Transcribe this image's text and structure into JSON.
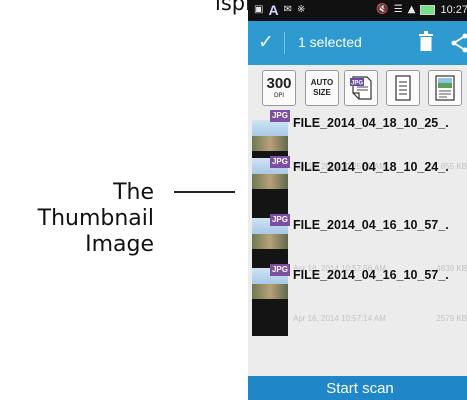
{
  "caption": {
    "top_text": "isplayed."
  },
  "annotation": {
    "line1": "The",
    "line2": "Thumbnail",
    "line3": "Image"
  },
  "status_bar": {
    "time": "10:27"
  },
  "action_bar": {
    "title": "1 selected"
  },
  "toolbar": {
    "resolution_value": "300",
    "resolution_unit": "DPI",
    "auto_size_line1": "AUTO",
    "auto_size_line2": "SIZE",
    "jpg_icon_label": "JPG"
  },
  "files": [
    {
      "name": "FILE_2014_04_18_10_25_.",
      "date": "Apr 18, 2014 10:25:55 AM",
      "size": "855 KB",
      "type": "JPG"
    },
    {
      "name": "FILE_2014_04_18_10_24_.",
      "date": "",
      "size": "",
      "type": "JPG"
    },
    {
      "name": "FILE_2014_04_16_10_57_.",
      "date": "Apr 16, 2014 10:57:56 AM",
      "size": "4839 KB",
      "type": "JPG"
    },
    {
      "name": "FILE_2014_04_16_10_57_.",
      "date": "Apr 16, 2014 10:57:14 AM",
      "size": "2579 KB",
      "type": "JPG"
    }
  ],
  "scan_button": {
    "label": "Start scan"
  }
}
